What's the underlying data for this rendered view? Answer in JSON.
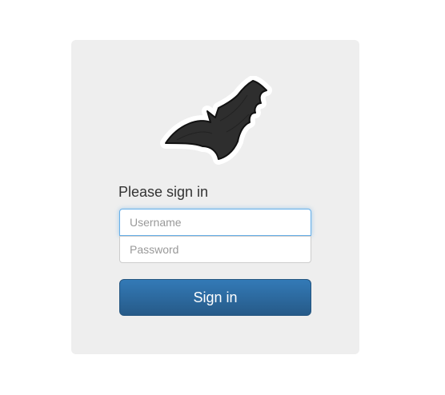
{
  "login": {
    "logo_icon": "bat-icon",
    "heading": "Please sign in",
    "username": {
      "placeholder": "Username",
      "value": ""
    },
    "password": {
      "placeholder": "Password",
      "value": ""
    },
    "submit_label": "Sign in"
  },
  "colors": {
    "card_background": "#eeeeee",
    "button_primary": "#337ab7",
    "focus_border": "#66afe9"
  }
}
